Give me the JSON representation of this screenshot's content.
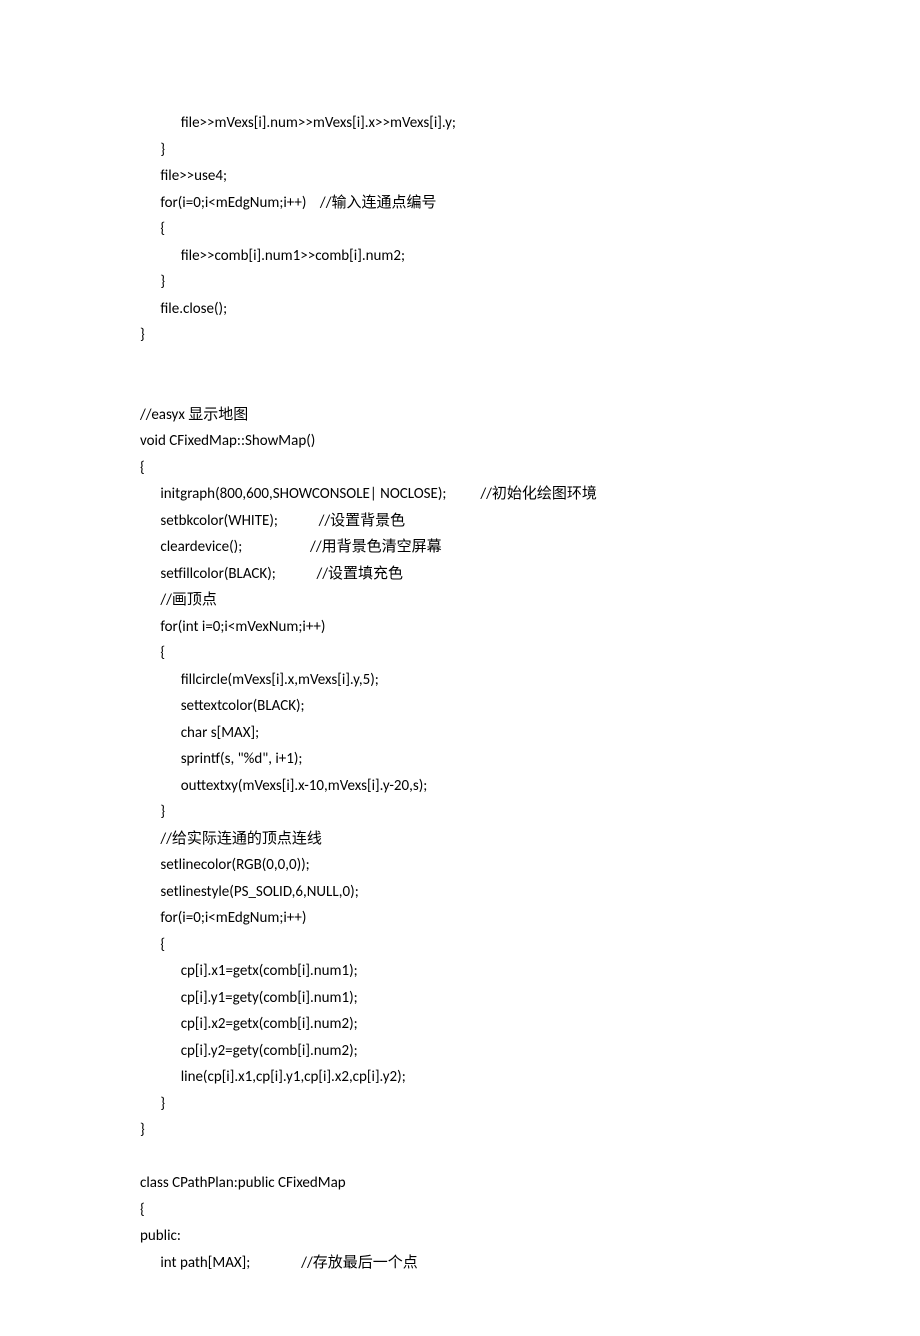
{
  "code": {
    "line1": "            file>>mVexs[i].num>>mVexs[i].x>>mVexs[i].y;",
    "line2": "      }",
    "line3": "      file>>use4;",
    "line4": "      for(i=0;i<mEdgNum;i++)    //输入连通点编号",
    "line5": "      {",
    "line6": "            file>>comb[i].num1>>comb[i].num2;",
    "line7": "      }",
    "line8": "      file.close();",
    "line9": "}",
    "line10": "",
    "line11": "",
    "line12": "//easyx 显示地图",
    "line13": "void CFixedMap::ShowMap()",
    "line14": "{",
    "line15": "      initgraph(800,600,SHOWCONSOLE| NOCLOSE);          //初始化绘图环境",
    "line16": "      setbkcolor(WHITE);            //设置背景色",
    "line17": "      cleardevice();                    //用背景色清空屏幕",
    "line18": "      setfillcolor(BLACK);            //设置填充色",
    "line19": "      //画顶点",
    "line20": "      for(int i=0;i<mVexNum;i++)",
    "line21": "      {",
    "line22": "            fillcircle(mVexs[i].x,mVexs[i].y,5);",
    "line23": "            settextcolor(BLACK);",
    "line24": "            char s[MAX];",
    "line25": "            sprintf(s, \"%d\", i+1);",
    "line26": "            outtextxy(mVexs[i].x-10,mVexs[i].y-20,s);",
    "line27": "      }",
    "line28": "      //给实际连通的顶点连线",
    "line29": "      setlinecolor(RGB(0,0,0));",
    "line30": "      setlinestyle(PS_SOLID,6,NULL,0);",
    "line31": "      for(i=0;i<mEdgNum;i++)",
    "line32": "      {",
    "line33": "            cp[i].x1=getx(comb[i].num1);",
    "line34": "            cp[i].y1=gety(comb[i].num1);",
    "line35": "            cp[i].x2=getx(comb[i].num2);",
    "line36": "            cp[i].y2=gety(comb[i].num2);",
    "line37": "            line(cp[i].x1,cp[i].y1,cp[i].x2,cp[i].y2);",
    "line38": "      }",
    "line39": "}",
    "line40": "",
    "line41": "class CPathPlan:public CFixedMap",
    "line42": "{",
    "line43": "public:",
    "line44": "      int path[MAX];               //存放最后一个点"
  }
}
